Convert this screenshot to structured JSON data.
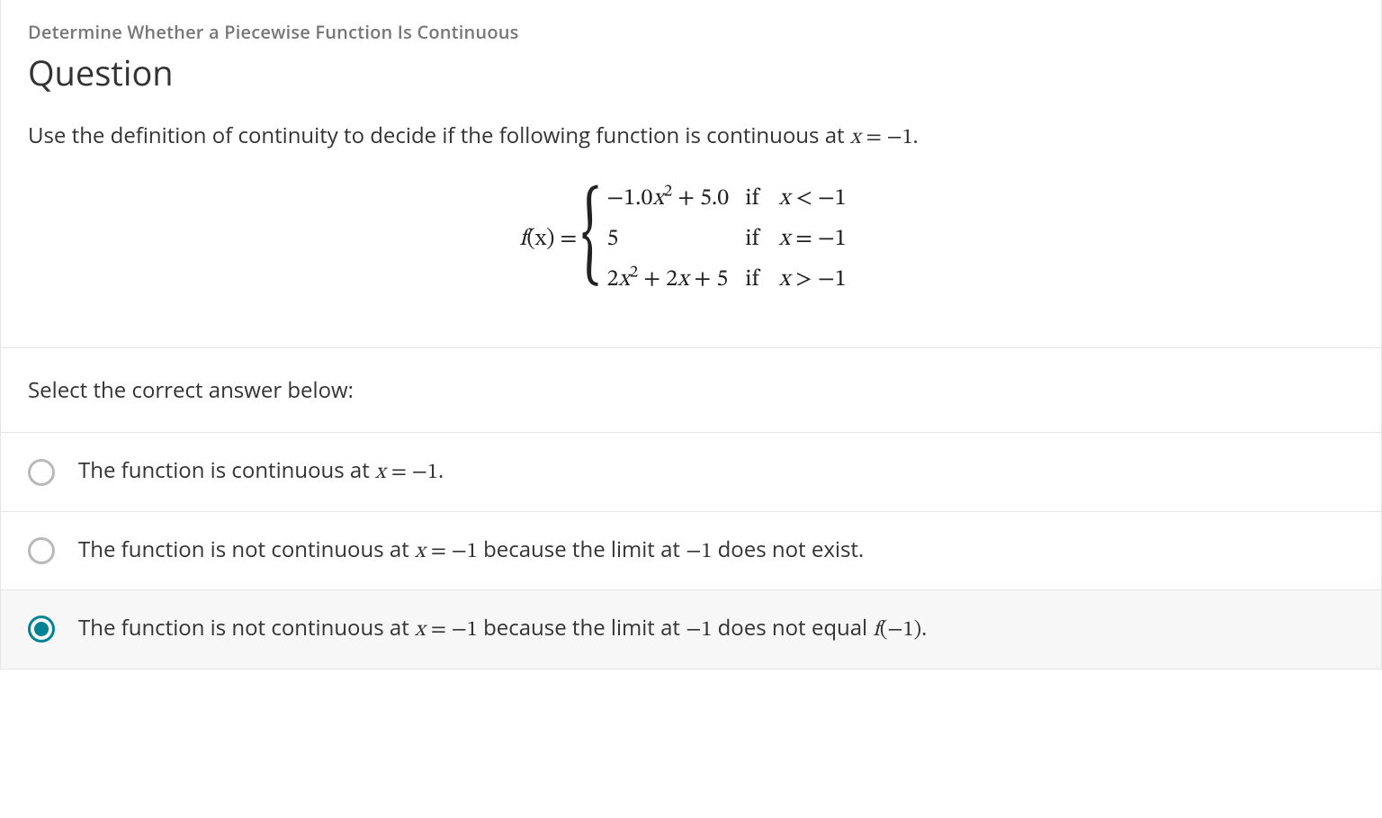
{
  "topic": "Determine Whether a Piecewise Function Is Continuous",
  "title": "Question",
  "instruction_prefix": "Use the definition of continuity to decide if the following function is continuous at ",
  "instruction_math": "x = −1.",
  "fx": {
    "lhs_f": "f",
    "lhs_x": "(x)",
    "eq": " = ",
    "rows": [
      {
        "expr_html": "−1.0<span class='math-i'>x</span><sup>2</sup> + 5.0",
        "if": "if",
        "cond_html": "<span class='math-i'>x</span> < −1"
      },
      {
        "expr_html": "5",
        "if": "if",
        "cond_html": "<span class='math-i'>x</span> = −1"
      },
      {
        "expr_html": "2<span class='math-i'>x</span><sup>2</sup> + 2<span class='math-i'>x</span> + 5",
        "if": "if",
        "cond_html": "<span class='math-i'>x</span> > −1"
      }
    ]
  },
  "select_prompt": "Select the correct answer below:",
  "choices": [
    {
      "selected": false,
      "html": "The function is continuous at <span class='math-i'>x</span> <span class='math-o'>= −1</span>."
    },
    {
      "selected": false,
      "html": "The function is not continuous at <span class='math-i'>x</span> <span class='math-o'>= −1</span> because the limit at <span class='math-o'>−1</span> does not exist."
    },
    {
      "selected": true,
      "html": "The function is not continuous at <span class='math-i'>x</span> <span class='math-o'>= −1</span> because the limit at <span class='math-o'>−1</span> does not equal <span class='math-i'>f</span><span class='math-o'>(−1)</span>."
    }
  ]
}
